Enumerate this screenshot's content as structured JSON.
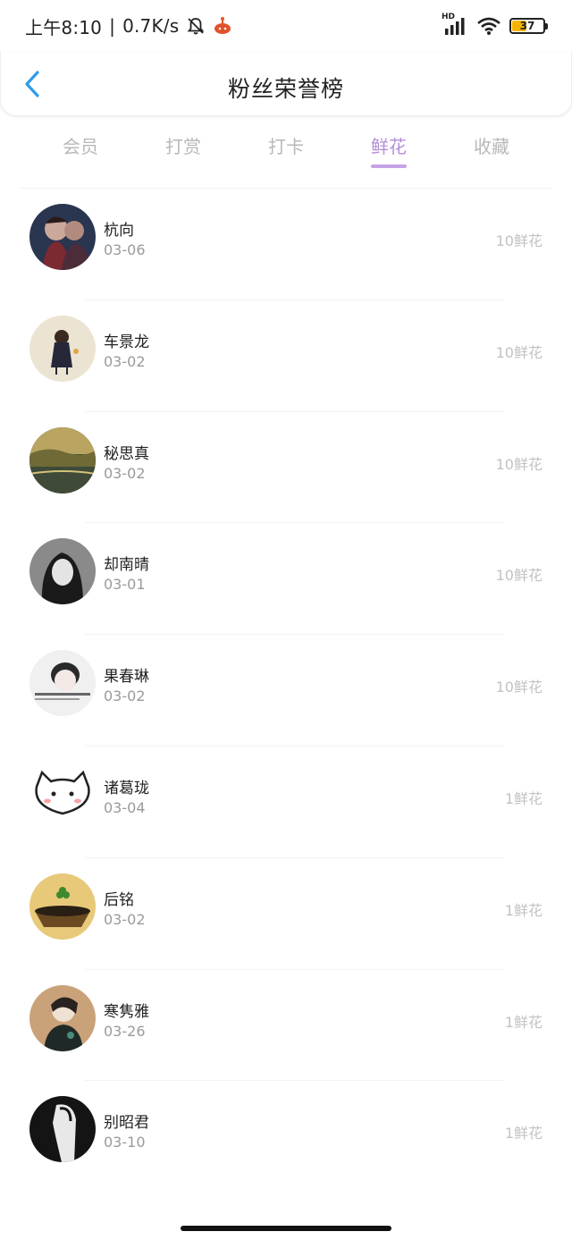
{
  "status": {
    "time": "上午8:10",
    "net_speed": "0.7K/s",
    "battery": "37",
    "hd_label": "HD"
  },
  "header": {
    "title": "粉丝荣誉榜"
  },
  "tabs": [
    {
      "label": "会员",
      "active": false
    },
    {
      "label": "打赏",
      "active": false
    },
    {
      "label": "打卡",
      "active": false
    },
    {
      "label": "鲜花",
      "active": true
    },
    {
      "label": "收藏",
      "active": false
    }
  ],
  "fans": [
    {
      "name": "杭向",
      "date": "03-06",
      "count": "10鲜花"
    },
    {
      "name": "车景龙",
      "date": "03-02",
      "count": "10鲜花"
    },
    {
      "name": "秘思真",
      "date": "03-02",
      "count": "10鲜花"
    },
    {
      "name": "却南晴",
      "date": "03-01",
      "count": "10鲜花"
    },
    {
      "name": "果春琳",
      "date": "03-02",
      "count": "10鲜花"
    },
    {
      "name": "诸葛珑",
      "date": "03-04",
      "count": "1鲜花"
    },
    {
      "name": "后铭",
      "date": "03-02",
      "count": "1鲜花"
    },
    {
      "name": "寒隽雅",
      "date": "03-26",
      "count": "1鲜花"
    },
    {
      "name": "别昭君",
      "date": "03-10",
      "count": "1鲜花"
    }
  ],
  "colors": {
    "accent": "#b48fd8",
    "back_arrow": "#2f9be8"
  }
}
